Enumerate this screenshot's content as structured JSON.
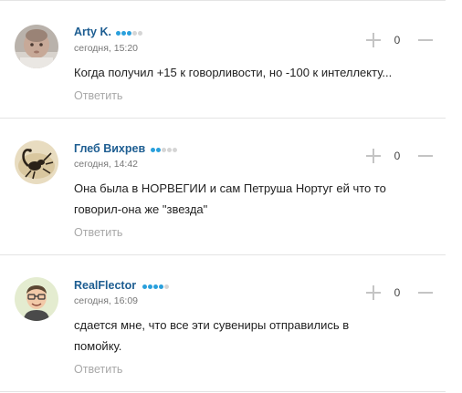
{
  "comments": [
    {
      "author": "Arty K.",
      "rating_level": 3,
      "rating_max": 5,
      "date": "сегодня, 15:20",
      "score": "0",
      "text": "Когда получил +15 к говорливости, но -100 к интеллекту...",
      "reply_label": "Ответить",
      "avatar": "baby-photo"
    },
    {
      "author": "Глеб Вихрев",
      "rating_level": 2,
      "rating_max": 5,
      "date": "сегодня, 14:42",
      "score": "0",
      "text": "Она была в НОРВЕГИИ и сам Петруша Нортуг ей что то\nговорил-она же \"звезда\"",
      "reply_label": "Ответить",
      "avatar": "scorpion-image"
    },
    {
      "author": "RealFlector",
      "rating_level": 4,
      "rating_max": 5,
      "date": "сегодня, 16:09",
      "score": "0",
      "text": "сдается мне, что все эти сувениры отправились в\nпомойку.",
      "reply_label": "Ответить",
      "avatar": "cartoon-man"
    }
  ],
  "colors": {
    "author": "#1d5d91",
    "rating_on": "#2aa0dc",
    "rating_off": "#d5d5d5",
    "reply": "#a8a8a8",
    "separator": "#e4e4e4"
  }
}
